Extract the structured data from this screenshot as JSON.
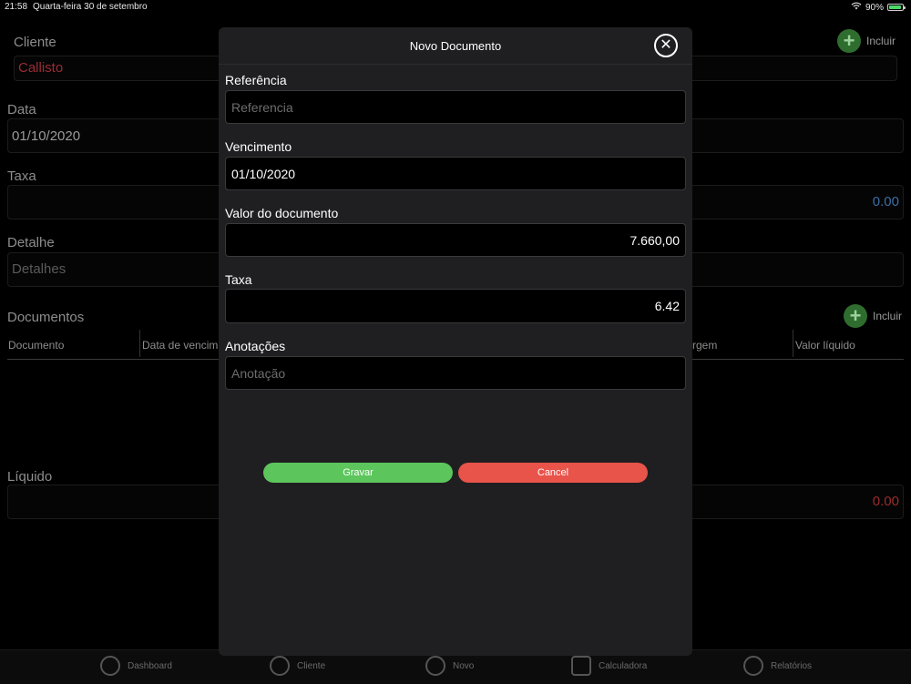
{
  "status": {
    "time": "21:58",
    "date": "Quarta-feira 30 de setembro",
    "battery": "90%",
    "battery_level": 0.9
  },
  "background": {
    "cliente_label": "Cliente",
    "cliente_value": "Callisto",
    "incluir": "Incluir",
    "data_label": "Data",
    "data_value": "01/10/2020",
    "taxa_label": "Taxa",
    "taxa_value": "0.00",
    "detalhe_label": "Detalhe",
    "detalhe_placeholder": "Detalhes",
    "documentos_label": "Documentos",
    "documentos_incluir": "Incluir",
    "columns": [
      "Documento",
      "Data de vencim",
      "rgem",
      "Valor líquido"
    ],
    "liquido_label": "Líquido",
    "liquido_value": "0.00"
  },
  "tabs": [
    "Dashboard",
    "Cliente",
    "Novo",
    "Calculadora",
    "Relatórios"
  ],
  "modal": {
    "title": "Novo Documento",
    "referencia_label": "Referência",
    "referencia_placeholder": "Referencia",
    "vencimento_label": "Vencimento",
    "vencimento_value": "01/10/2020",
    "valor_label": "Valor do documento",
    "valor_value": "7.660,00",
    "taxa_label": "Taxa",
    "taxa_value": "6.42",
    "anotacoes_label": "Anotações",
    "anotacoes_placeholder": "Anotação",
    "save_label": "Gravar",
    "cancel_label": "Cancel"
  },
  "colors": {
    "accent_green": "#5cc65c",
    "danger_red": "#e8534a",
    "modal_bg": "#1f1f21"
  }
}
